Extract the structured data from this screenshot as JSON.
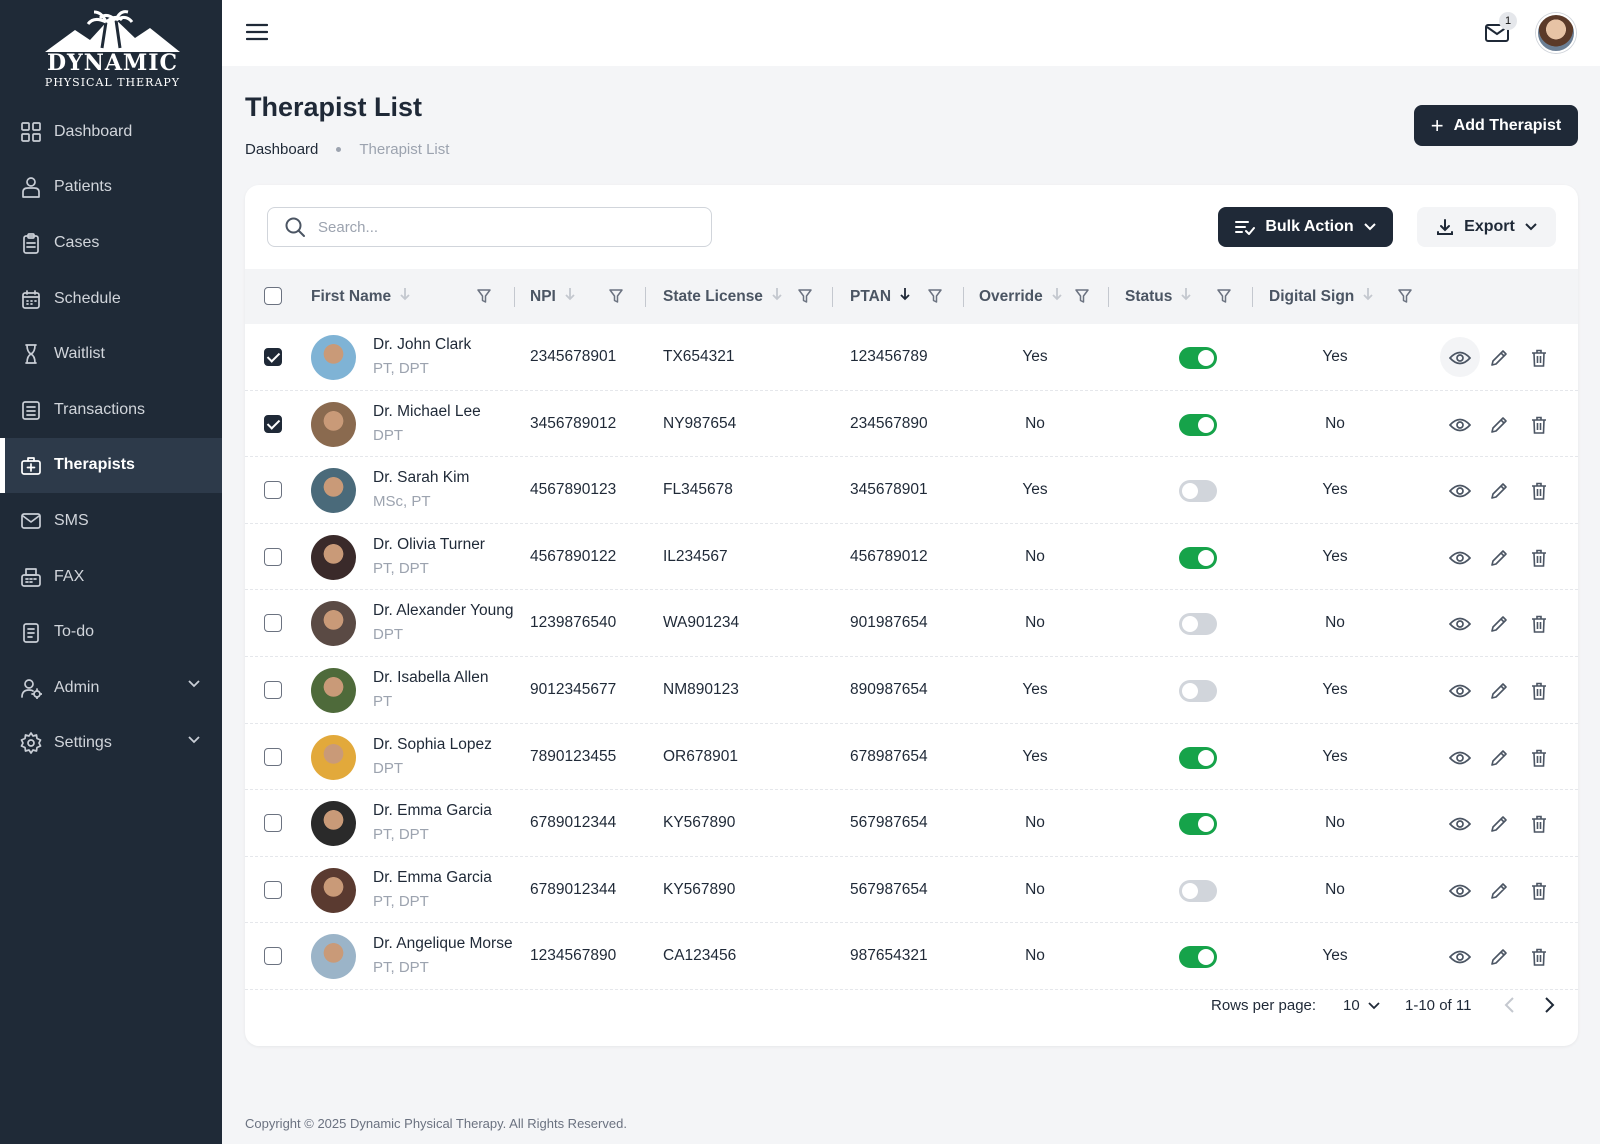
{
  "brand": {
    "name": "DYNAMIC",
    "subtitle": "PHYSICAL THERAPY"
  },
  "sidebar": {
    "items": [
      {
        "label": "Dashboard",
        "icon": "grid-icon"
      },
      {
        "label": "Patients",
        "icon": "patient-icon"
      },
      {
        "label": "Cases",
        "icon": "clipboard-icon"
      },
      {
        "label": "Schedule",
        "icon": "calendar-icon"
      },
      {
        "label": "Waitlist",
        "icon": "hourglass-icon"
      },
      {
        "label": "Transactions",
        "icon": "list-icon"
      },
      {
        "label": "Therapists",
        "icon": "medical-kit-icon",
        "active": true
      },
      {
        "label": "SMS",
        "icon": "message-icon"
      },
      {
        "label": "FAX",
        "icon": "fax-icon"
      },
      {
        "label": "To-do",
        "icon": "todo-icon"
      },
      {
        "label": "Admin",
        "icon": "admin-icon",
        "expandable": true
      },
      {
        "label": "Settings",
        "icon": "gear-icon",
        "expandable": true
      }
    ]
  },
  "topbar": {
    "notification_count": "1"
  },
  "page": {
    "title": "Therapist List",
    "breadcrumb": [
      "Dashboard",
      "Therapist List"
    ],
    "add_button": "Add Therapist"
  },
  "toolbar": {
    "search_placeholder": "Search...",
    "bulk_action": "Bulk Action",
    "export": "Export"
  },
  "table": {
    "columns": [
      "First Name",
      "NPI",
      "State License",
      "PTAN",
      "Override",
      "Status",
      "Digital Sign"
    ],
    "sorted_column": "PTAN",
    "rows": [
      {
        "selected": true,
        "name": "Dr. John Clark",
        "credentials": "PT, DPT",
        "npi": "2345678901",
        "license": "TX654321",
        "ptan": "123456789",
        "override": "Yes",
        "status": true,
        "digital_sign": "Yes",
        "avatar_color": "#7fb3d5"
      },
      {
        "selected": true,
        "name": "Dr. Michael Lee",
        "credentials": "DPT",
        "npi": "3456789012",
        "license": "NY987654",
        "ptan": "234567890",
        "override": "No",
        "status": true,
        "digital_sign": "No",
        "avatar_color": "#8a6a4f"
      },
      {
        "selected": false,
        "name": "Dr. Sarah Kim",
        "credentials": "MSc, PT",
        "npi": "4567890123",
        "license": "FL345678",
        "ptan": "345678901",
        "override": "Yes",
        "status": false,
        "digital_sign": "Yes",
        "avatar_color": "#4a6a7a"
      },
      {
        "selected": false,
        "name": "Dr. Olivia Turner",
        "credentials": "PT, DPT",
        "npi": "4567890122",
        "license": "IL234567",
        "ptan": "456789012",
        "override": "No",
        "status": true,
        "digital_sign": "Yes",
        "avatar_color": "#3a2a2a"
      },
      {
        "selected": false,
        "name": "Dr. Alexander Young",
        "credentials": "DPT",
        "npi": "1239876540",
        "license": "WA901234",
        "ptan": "901987654",
        "override": "No",
        "status": false,
        "digital_sign": "No",
        "avatar_color": "#5a4a44"
      },
      {
        "selected": false,
        "name": "Dr. Isabella Allen",
        "credentials": "PT",
        "npi": "9012345677",
        "license": "NM890123",
        "ptan": "890987654",
        "override": "Yes",
        "status": false,
        "digital_sign": "Yes",
        "avatar_color": "#4e6a3a"
      },
      {
        "selected": false,
        "name": "Dr. Sophia Lopez",
        "credentials": "DPT",
        "npi": "7890123455",
        "license": "OR678901",
        "ptan": "678987654",
        "override": "Yes",
        "status": true,
        "digital_sign": "Yes",
        "avatar_color": "#e2a93b"
      },
      {
        "selected": false,
        "name": "Dr. Emma Garcia",
        "credentials": "PT, DPT",
        "npi": "6789012344",
        "license": "KY567890",
        "ptan": "567987654",
        "override": "No",
        "status": true,
        "digital_sign": "No",
        "avatar_color": "#2a2a2a"
      },
      {
        "selected": false,
        "name": "Dr. Emma Garcia",
        "credentials": "PT, DPT",
        "npi": "6789012344",
        "license": "KY567890",
        "ptan": "567987654",
        "override": "No",
        "status": false,
        "digital_sign": "No",
        "avatar_color": "#5a3a30"
      },
      {
        "selected": false,
        "name": "Dr. Angelique Morse",
        "credentials": "PT, DPT",
        "npi": "1234567890",
        "license": "CA123456",
        "ptan": "987654321",
        "override": "No",
        "status": true,
        "digital_sign": "Yes",
        "avatar_color": "#9bb4c8"
      }
    ]
  },
  "pagination": {
    "rows_label": "Rows per page:",
    "rows_value": "10",
    "range": "1-10 of 11"
  },
  "footer": "Copyright © 2025 Dynamic Physical Therapy. All Rights Reserved.",
  "colors": {
    "sidebar": "#1f2a37",
    "primary": "#1f2937",
    "toggle_on": "#16a34a",
    "toggle_off": "#d1d5db"
  }
}
